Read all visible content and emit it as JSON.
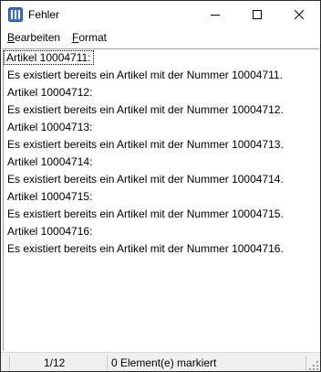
{
  "window": {
    "title": "Fehler",
    "icon": "app-icon",
    "controls": [
      "minimize-icon",
      "maximize-icon",
      "close-icon"
    ]
  },
  "menu": {
    "edit": {
      "accelerator": "B",
      "rest": "earbeiten"
    },
    "format": {
      "accelerator": "F",
      "rest": "ormat"
    }
  },
  "content": {
    "lines": [
      "Artikel 10004711:",
      "Es existiert bereits ein Artikel mit der Nummer 10004711.",
      "Artikel 10004712:",
      "Es existiert bereits ein Artikel mit der Nummer 10004712.",
      "Artikel 10004713:",
      "Es existiert bereits ein Artikel mit der Nummer 10004713.",
      "Artikel 10004714:",
      "Es existiert bereits ein Artikel mit der Nummer 10004714.",
      "Artikel 10004715:",
      "Es existiert bereits ein Artikel mit der Nummer 10004715.",
      "Artikel 10004716:",
      "Es existiert bereits ein Artikel mit der Nummer 10004716."
    ]
  },
  "status": {
    "position": "1/12",
    "selection": "0 Element(e) markiert"
  },
  "colors": {
    "icon_blue": "#3a6fd0",
    "statusbar_bg": "#f0f0f0"
  }
}
